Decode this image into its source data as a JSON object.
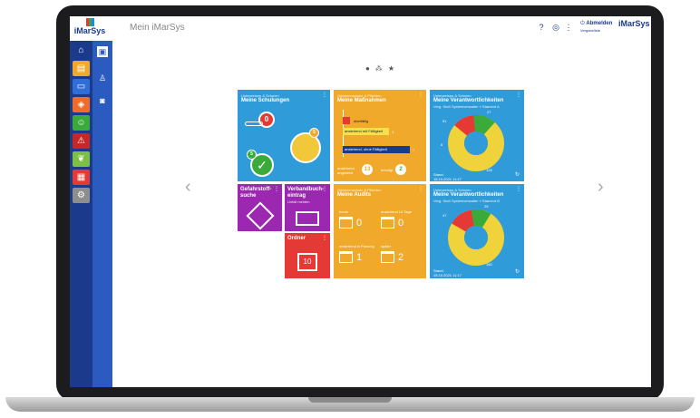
{
  "app": {
    "logo": "iMarSys",
    "title": "Mein iMarSys",
    "logout_label": "Abmelden",
    "logout_sub": "Vergabeliste",
    "logo_right": "iMarSys"
  },
  "sidebar": {
    "items": [
      {
        "icon": "home-icon",
        "color": "#1b3a8c"
      },
      {
        "icon": "document-icon",
        "color": "#f0a92a"
      },
      {
        "icon": "laptop-icon",
        "color": "#2f6ed8"
      },
      {
        "icon": "graduation-icon",
        "color": "#ef6c2b"
      },
      {
        "icon": "person-icon",
        "color": "#3aaa3a"
      },
      {
        "icon": "warning-icon",
        "color": "#c62828"
      },
      {
        "icon": "leaf-icon",
        "color": "#7cc043"
      },
      {
        "icon": "file-icon",
        "color": "#e53935"
      },
      {
        "icon": "gear-icon",
        "color": "#8e8e8e"
      }
    ]
  },
  "tiles": {
    "schulungen": {
      "sub": "Unterweisen & Schulen",
      "title": "Meine Schulungen",
      "overdue": "0",
      "upcoming": "5",
      "done": "5",
      "color": "#2f9bd8"
    },
    "massnahmen": {
      "sub": "Gefahrenschutz & Pflichten",
      "title": "Meine Maßnahmen",
      "bars": [
        {
          "label": "überfällig",
          "value": "1"
        },
        {
          "label": "anstehend mit Fälligkeit",
          "value": "1"
        },
        {
          "label": "anstehend, ohne Fälligkeit",
          "value": "7"
        }
      ],
      "left_label": "anstehend angesetzt",
      "left_value": "13",
      "right_label": "erledigt",
      "right_value": "2",
      "color": "#f0a92a"
    },
    "verantwortlichkeiten_a": {
      "sub": "Unterweisen & Schulen",
      "title": "Meine Verantwortlichkeiten",
      "desc": "Verg. Stoß Systemverwalter » Standort A",
      "stand": "Stand:",
      "date": "15.10.2021 11:17",
      "values": [
        "27",
        "51",
        "8",
        "128"
      ],
      "color": "#2f9bd8"
    },
    "gefahrstoff": {
      "title": "Gefahrstoff-suche",
      "color": "#9c27b0"
    },
    "verbandbuch": {
      "title": "Verbandbuch-eintrag",
      "sub": "Unfall melden",
      "color": "#9c27b0"
    },
    "audits": {
      "sub": "Gefahrenschutz & Pflichten",
      "title": "Meine Audits",
      "items": [
        {
          "label": "heute",
          "value": "0"
        },
        {
          "label": "anstehend 14 Tage",
          "value": "0"
        },
        {
          "label": "anstehend in Planung",
          "value": "1"
        },
        {
          "label": "später",
          "value": "2"
        }
      ],
      "color": "#f0a92a"
    },
    "ordner": {
      "title": "Ordner",
      "count": "10",
      "color": "#e53935"
    },
    "verantwortlichkeiten_b": {
      "sub": "Unterweisen & Schulen",
      "title": "Meine Verantwortlichkeiten",
      "desc": "Verg. Stoß Systemverwalter » Standort B",
      "stand": "Stand:",
      "date": "15.10.2021 11:17",
      "values": [
        "25",
        "47",
        "160"
      ],
      "color": "#2f9bd8"
    }
  },
  "nav": {
    "prev": "‹",
    "next": "›"
  }
}
